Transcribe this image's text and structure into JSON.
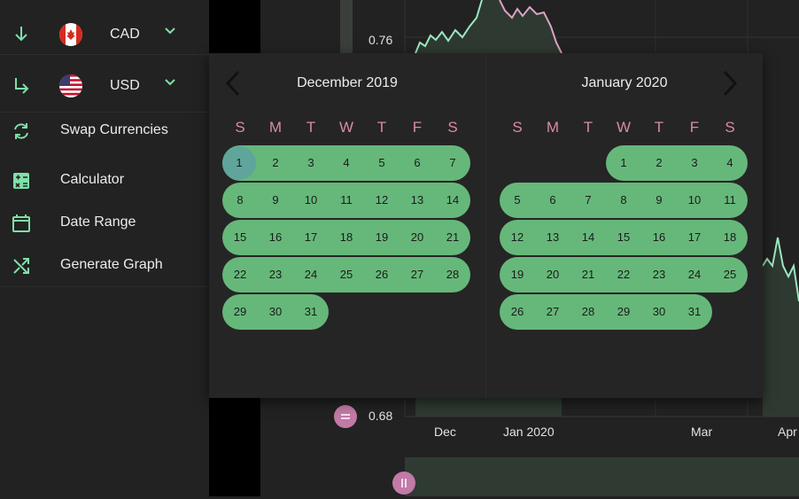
{
  "sidebar": {
    "from_currency": {
      "code": "CAD",
      "flag": "canada-flag",
      "icon": "arrow-down-icon"
    },
    "to_currency": {
      "code": "USD",
      "flag": "usa-flag",
      "icon": "arrow-turn-down-right-icon"
    },
    "items": [
      {
        "label": "Swap Currencies",
        "icon": "swap-icon"
      },
      {
        "label": "Calculator",
        "icon": "calculator-icon"
      },
      {
        "label": "Date Range",
        "icon": "calendar-icon"
      },
      {
        "label": "Generate Graph",
        "icon": "shuffle-icon"
      }
    ]
  },
  "graph": {
    "y_ticks": [
      "0.76",
      "0.68"
    ],
    "x_ticks": [
      "Dec",
      "Jan 2020",
      "Mar",
      "Apr"
    ]
  },
  "calendar": {
    "weekdays": [
      "S",
      "M",
      "T",
      "W",
      "T",
      "F",
      "S"
    ],
    "selected_day": "1",
    "months": [
      {
        "title": "December 2019",
        "first_weekday": 0,
        "days": 31
      },
      {
        "title": "January 2020",
        "first_weekday": 3,
        "days": 31
      }
    ]
  },
  "colors": {
    "accent_green": "#66b87a",
    "selected_day": "#5fa59b",
    "weekday_pink": "#d98aa8",
    "icon_green": "#7fe0a8",
    "handle_pink": "#c27aa7",
    "line_green": "#9be8c0"
  }
}
